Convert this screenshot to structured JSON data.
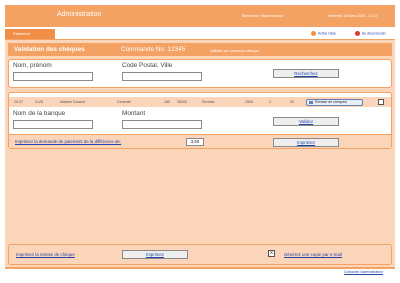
{
  "header": {
    "title": "Administration",
    "welcome": "Bienvenue: Marie Durand",
    "datetime": "Vendredi 13 Mars 2009 - 21:12"
  },
  "subnav": {
    "tab": "Paiement",
    "help": "Activé l'aide",
    "logout": "Se déconnecter",
    "help_icon": "help-dot-icon",
    "logout_icon": "logout-dot-icon"
  },
  "section": {
    "title": "Validation des chèques",
    "order": "Commande No: 12345",
    "validate_new": "Validez un nouveau chèque"
  },
  "search": {
    "name_label": "Nom, prénom",
    "name_value": "",
    "city_label": "Code Postal, Ville",
    "city_value": "",
    "search_button": "Recherchez"
  },
  "results": {
    "rows": [
      {
        "date": "26.07",
        "num": "0125",
        "name": "Martine Durand",
        "street": "Centrale",
        "house": "180",
        "zip": "35000",
        "city": "Rennes",
        "value": "2594",
        "a": "2",
        "b": "20",
        "action": "Remise de chèques"
      }
    ]
  },
  "bank": {
    "bank_label": "Nom de la banque",
    "bank_value": "",
    "amount_label": "Montant",
    "amount_value": "",
    "validate_button": "Validez"
  },
  "difference": {
    "link": "Imprimez la demande de paiement de la différence de:",
    "amount": "3,50",
    "print_button": "Imprimez"
  },
  "bottom": {
    "print_link": "Imprimez la remise de chèque",
    "print_button": "Imprimez",
    "copy_link": "Générez une copie par e-mail",
    "x_label": "X"
  },
  "footer": {
    "contact": "Contactez l'administrateur"
  }
}
